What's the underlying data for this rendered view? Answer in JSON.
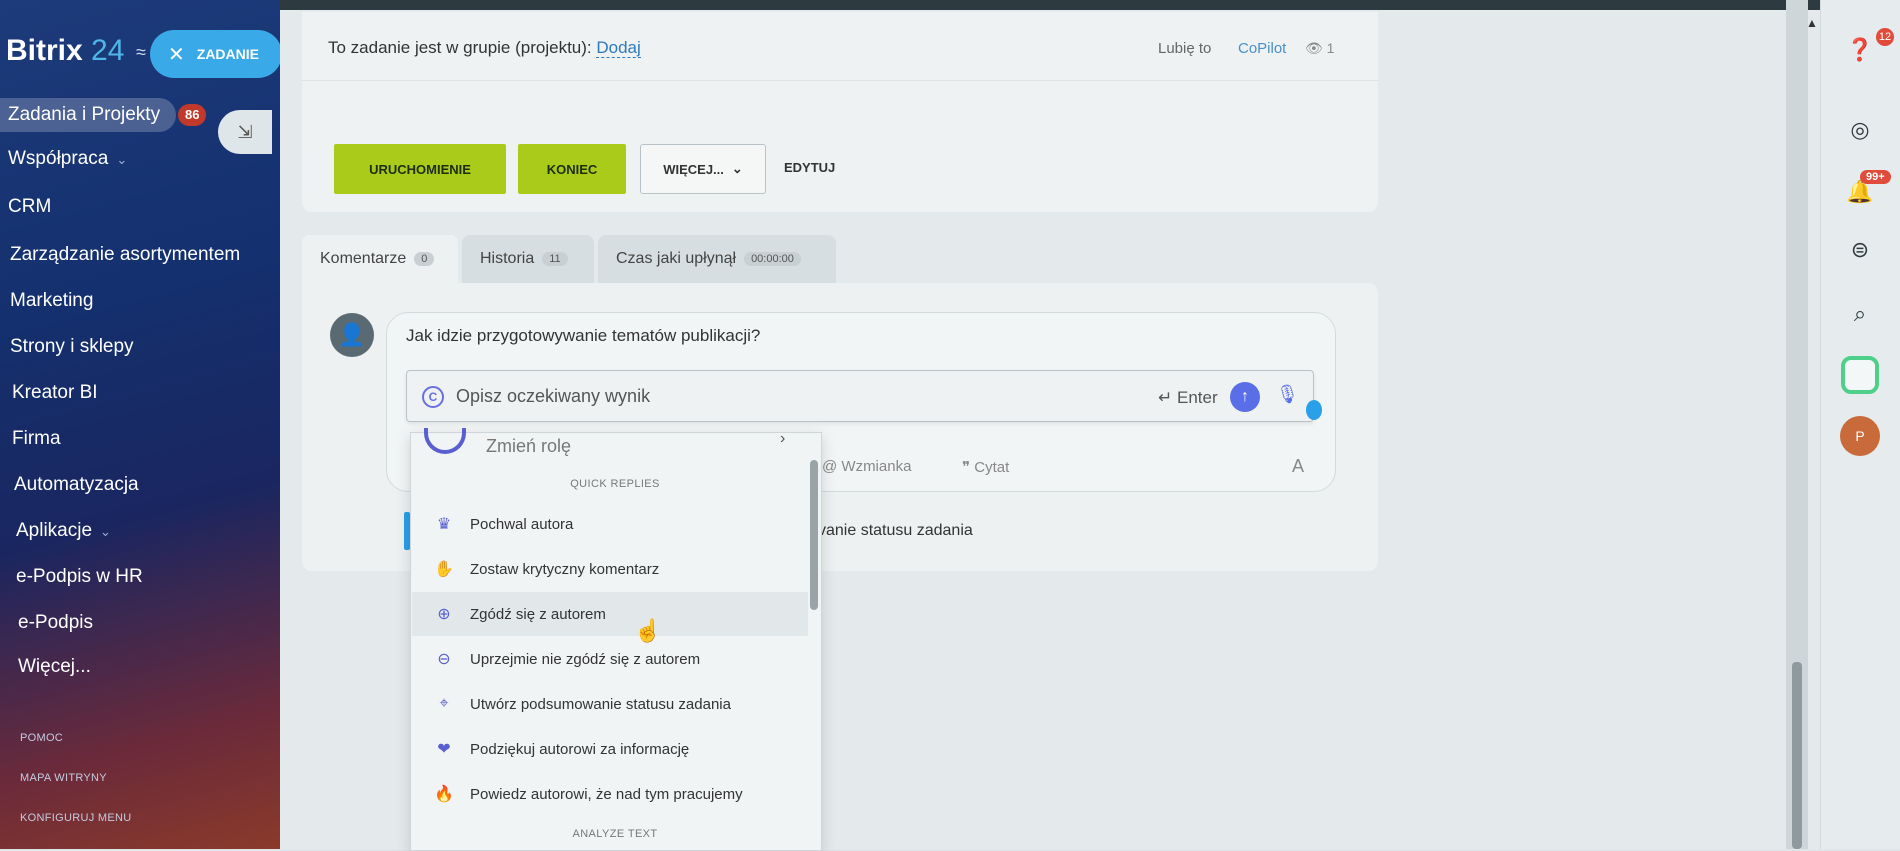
{
  "sidebar": {
    "logo_name": "Bitrix",
    "logo_num": "24",
    "close_label": "ZADANIE",
    "active_item": "Zadania i Projekty",
    "active_badge": "86",
    "items": [
      "Współpraca",
      "CRM",
      "Zarządzanie asortymentem",
      "Marketing",
      "Strony i sklepy",
      "Kreator BI",
      "Firma",
      "Automatyzacja",
      "Aplikacje",
      "e-Podpis w HR",
      "e-Podpis",
      "Więcej..."
    ],
    "footer": [
      "POMOC",
      "MAPA WITRYNY",
      "KONFIGURUJ MENU"
    ]
  },
  "task": {
    "group_text": "To zadanie jest w grupie (projektu):",
    "group_link": "Dodaj",
    "like_label": "Lubię to",
    "copilot_label": "CoPilot",
    "views": "1",
    "buttons": {
      "start": "URUCHOMIENIE",
      "finish": "KONIEC",
      "more": "WIĘCEJ...",
      "edit": "EDYTUJ"
    }
  },
  "tabs": [
    {
      "label": "Komentarze",
      "badge": "0"
    },
    {
      "label": "Historia",
      "badge": "11"
    },
    {
      "label": "Czas jaki upłynął",
      "badge": "00:00:00"
    }
  ],
  "comment": {
    "text": "Jak idzie przygotowywanie tematów publikacji?",
    "copilot_placeholder": "Opisz oczekiwany wynik",
    "enter_label": "Enter",
    "mention_label": "Wzmianka",
    "quote_label": "Cytat",
    "font_label": "A",
    "status_partial": "vanie statusu zadania"
  },
  "dropdown": {
    "role_label": "Zmień rolę",
    "section_quick": "QUICK REPLIES",
    "items": [
      {
        "label": "Pochwal autora",
        "icon": "crown-icon"
      },
      {
        "label": "Zostaw krytyczny komentarz",
        "icon": "hand-icon"
      },
      {
        "label": "Zgódź się z autorem",
        "icon": "plus-circle-icon"
      },
      {
        "label": "Uprzejmie nie zgódź się z autorem",
        "icon": "minus-circle-icon"
      },
      {
        "label": "Utwórz podsumowanie statusu zadania",
        "icon": "target-icon"
      },
      {
        "label": "Podziękuj autorowi za informację",
        "icon": "thanks-icon"
      },
      {
        "label": "Powiedz autorowi, że nad tym pracujemy",
        "icon": "flame-icon"
      }
    ],
    "section_analyze": "ANALYZE TEXT"
  },
  "rail": {
    "help_badge": "12",
    "bell_badge": "99+",
    "avatar_letter": "P"
  },
  "colors": {
    "accent_green": "#aacb1a",
    "accent_blue": "#2aa0e8",
    "copilot_purple": "#5a5fcf"
  }
}
